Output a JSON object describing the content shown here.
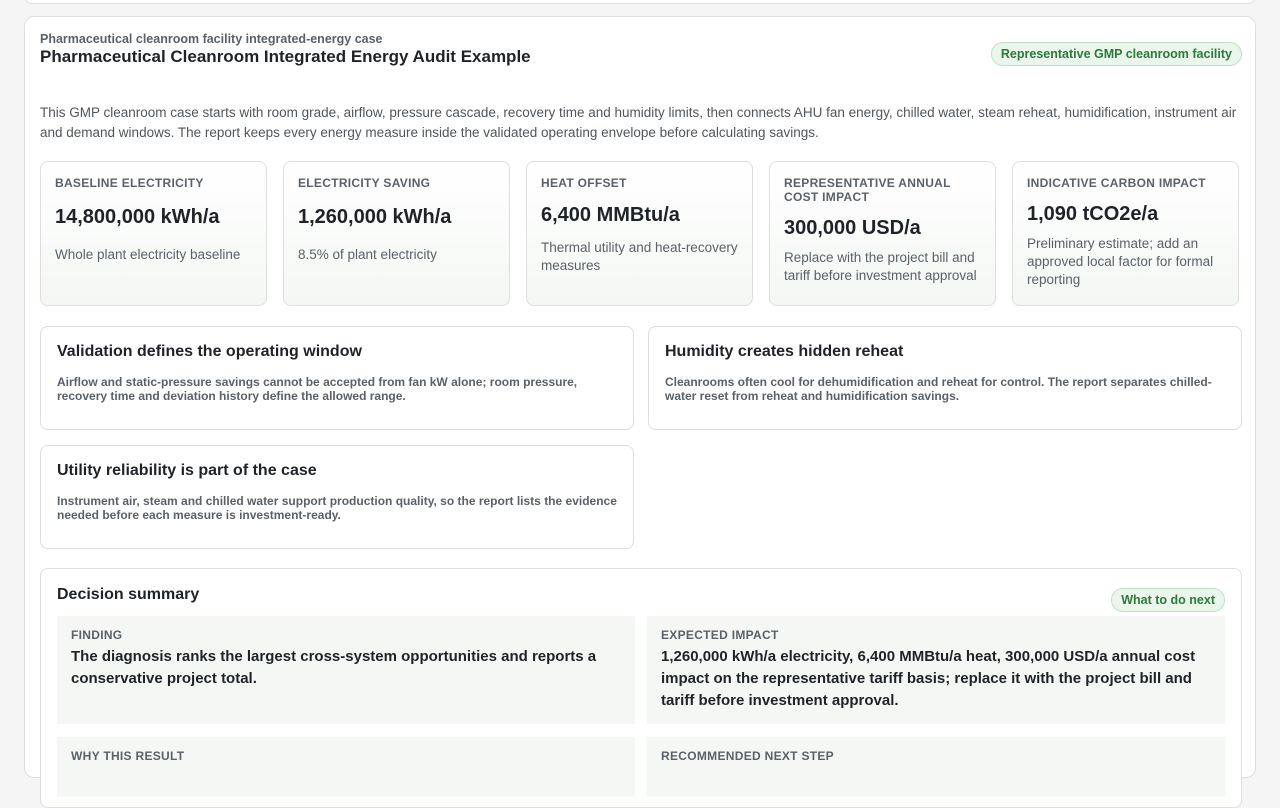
{
  "header": {
    "eyebrow": "Pharmaceutical cleanroom facility integrated-energy case",
    "title": "Pharmaceutical Cleanroom Integrated Energy Audit Example",
    "badge": "Representative GMP cleanroom facility"
  },
  "intro": "This GMP cleanroom case starts with room grade, airflow, pressure cascade, recovery time and humidity limits, then connects AHU fan energy, chilled water, steam reheat, humidification, instrument air and demand windows. The report keeps every energy measure inside the validated operating envelope before calculating savings.",
  "metrics": [
    {
      "label": "Baseline electricity",
      "value": "14,800,000 kWh/a",
      "note": "Whole plant electricity baseline"
    },
    {
      "label": "Electricity saving",
      "value": "1,260,000 kWh/a",
      "note": "8.5% of plant electricity"
    },
    {
      "label": "Heat offset",
      "value": "6,400 MMBtu/a",
      "note": "Thermal utility and heat-recovery measures"
    },
    {
      "label": "Representative annual cost impact",
      "value": "300,000 USD/a",
      "note": "Replace with the project bill and tariff before investment approval"
    },
    {
      "label": "Indicative carbon impact",
      "value": "1,090 tCO2e/a",
      "note": "Preliminary estimate; add an approved local factor for formal reporting"
    }
  ],
  "insights": [
    {
      "title": "Validation defines the operating window",
      "body": "Airflow and static-pressure savings cannot be accepted from fan kW alone; room pressure, recovery time and deviation history define the allowed range."
    },
    {
      "title": "Humidity creates hidden reheat",
      "body": "Cleanrooms often cool for dehumidification and reheat for control. The report separates chilled-water reset from reheat and humidification savings."
    },
    {
      "title": "Utility reliability is part of the case",
      "body": "Instrument air, steam and chilled water support production quality, so the report lists the evidence needed before each measure is investment-ready."
    }
  ],
  "decision": {
    "title": "Decision summary",
    "badge": "What to do next",
    "finding_label": "Finding",
    "finding_text": "The diagnosis ranks the largest cross-system opportunities and reports a conservative project total.",
    "impact_label": "Expected impact",
    "impact_text": "1,260,000 kWh/a electricity, 6,400 MMBtu/a heat, 300,000 USD/a annual cost impact on the representative tariff basis; replace it with the project bill and tariff before investment approval.",
    "why_label": "Why this result",
    "next_label": "Recommended next step"
  }
}
